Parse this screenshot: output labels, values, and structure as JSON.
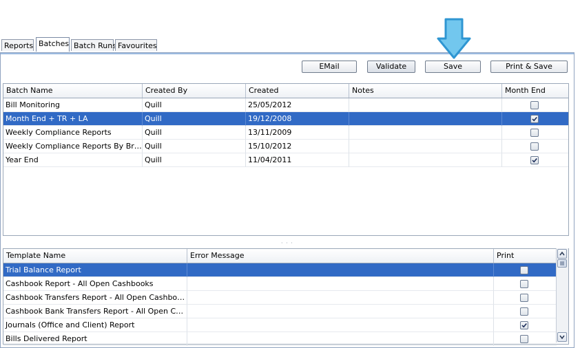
{
  "tabs": [
    {
      "label": "Reports"
    },
    {
      "label": "Batches",
      "active": true
    },
    {
      "label": "Batch Runs"
    },
    {
      "label": "Favourites"
    }
  ],
  "toolbar": {
    "email_label": "EMail",
    "validate_label": "Validate",
    "save_label": "Save",
    "print_save_label": "Print & Save"
  },
  "highlight_arrow": {
    "color": "#3aa8df",
    "icon": "arrow-down-icon"
  },
  "batches": {
    "columns": [
      "Batch Name",
      "Created By",
      "Created",
      "Notes",
      "Month End"
    ],
    "rows": [
      {
        "name": "Bill Monitoring",
        "created_by": "Quill",
        "created": "25/05/2012",
        "notes": "",
        "month_end": false
      },
      {
        "name": "Month End + TR + LA",
        "created_by": "Quill",
        "created": "19/12/2008",
        "notes": "",
        "month_end": true,
        "selected": true
      },
      {
        "name": "Weekly Compliance Reports",
        "created_by": "Quill",
        "created": "13/11/2009",
        "notes": "",
        "month_end": false
      },
      {
        "name": "Weekly Compliance Reports By Branch",
        "created_by": "Quill",
        "created": "15/10/2012",
        "notes": "",
        "month_end": false
      },
      {
        "name": "Year End",
        "created_by": "Quill",
        "created": "11/04/2011",
        "notes": "",
        "month_end": true
      }
    ]
  },
  "templates": {
    "columns": [
      "Template Name",
      "Error Message",
      "Print"
    ],
    "rows": [
      {
        "name": "Trial Balance Report",
        "error": "",
        "print": false,
        "selected": true
      },
      {
        "name": "Cashbook Report  - All Open Cashbooks",
        "error": "",
        "print": false
      },
      {
        "name": "Cashbook Transfers Report  - All Open Cashbooks",
        "error": "",
        "print": false
      },
      {
        "name": "Cashbook Bank Transfers Report  - All Open Cashb…",
        "error": "",
        "print": false
      },
      {
        "name": "Journals (Office and Client) Report",
        "error": "",
        "print": true
      },
      {
        "name": "Bills Delivered Report",
        "error": "",
        "print": false
      }
    ]
  },
  "splitter_glyph": "· · ·",
  "colors": {
    "selection": "#316ac5",
    "header_border": "#9aa7b8"
  }
}
